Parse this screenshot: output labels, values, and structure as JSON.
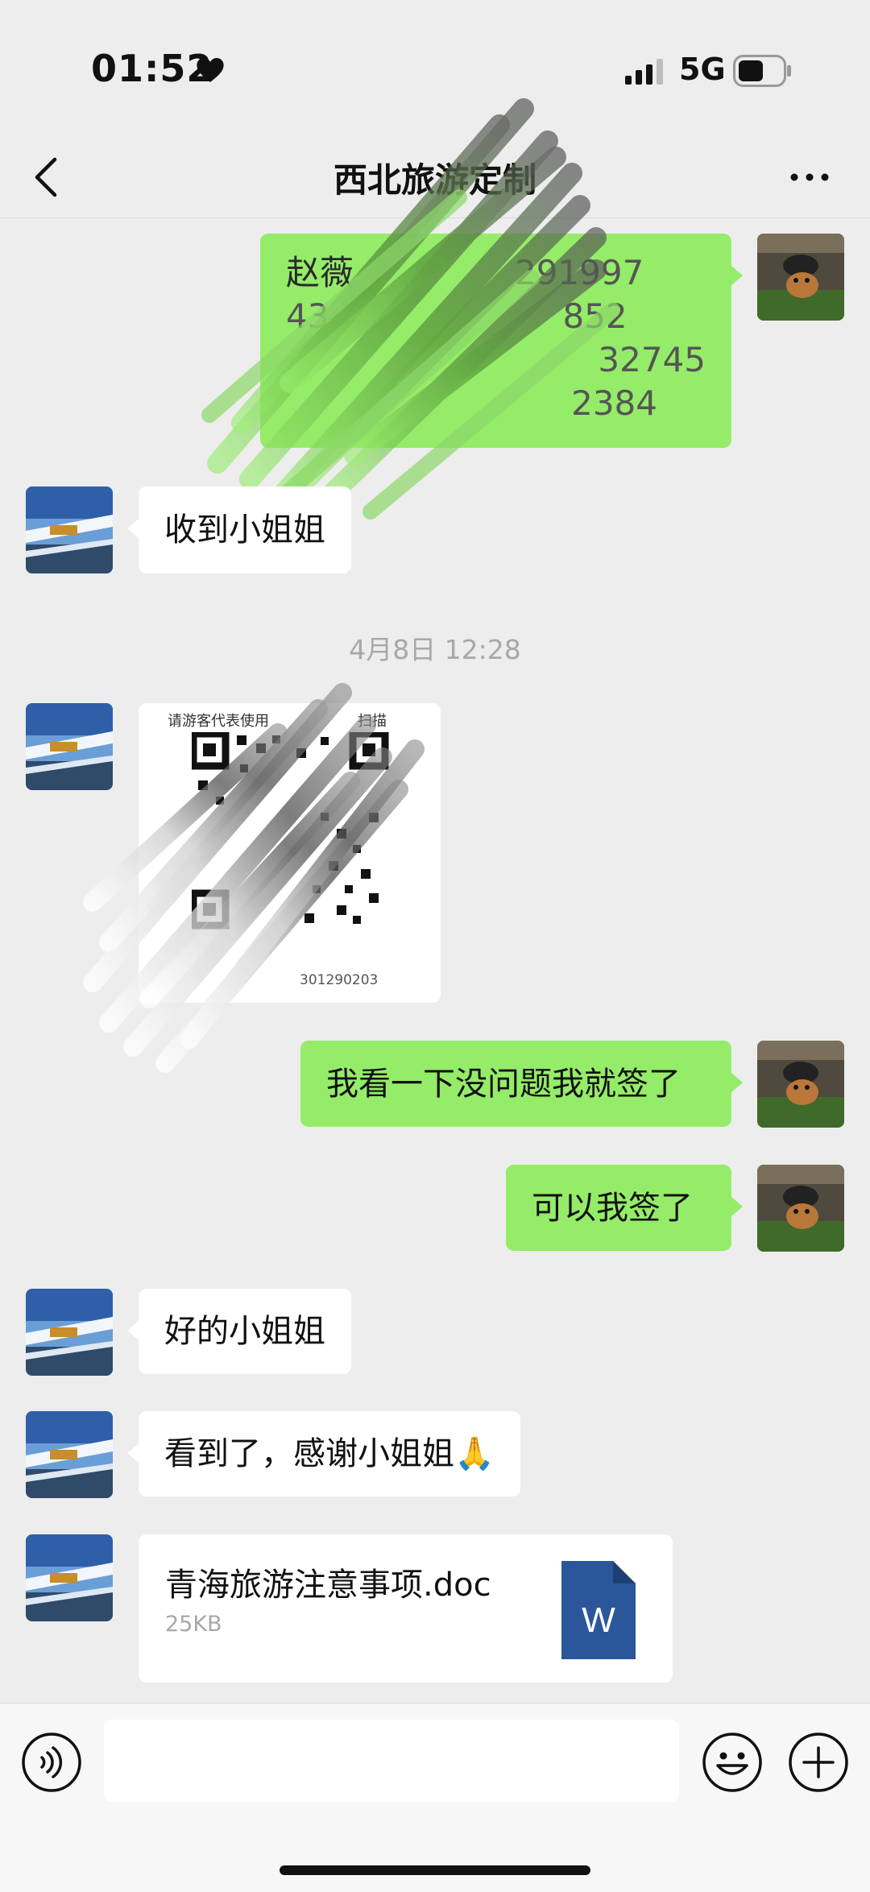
{
  "status_bar": {
    "time": "01:52",
    "network": "5G",
    "icons": [
      "heart-icon",
      "signal-icon",
      "battery-icon"
    ]
  },
  "nav": {
    "title": "西北旅游定制",
    "back_icon": "chevron-left-icon",
    "more_icon": "more-icon"
  },
  "colors": {
    "outgoing_bubble": "#95ec69",
    "incoming_bubble": "#ffffff",
    "background": "#ededed",
    "word_blue": "#2b579a"
  },
  "messages": {
    "m1": {
      "line1": "赵薇",
      "line1_tail": "291997",
      "line2a": "43",
      "line2b": "852",
      "line3": "32745",
      "line4": "2384"
    },
    "m2": "收到小姐姐",
    "timestamp": "4月8日 12:28",
    "qr": {
      "caption": "请游客代表使用",
      "caption_tail": "扫描",
      "code": "301290203"
    },
    "m4": "我看一下没问题我就签了",
    "m5": "可以我签了",
    "m6": "好的小姐姐",
    "m7": "看到了，感谢小姐姐🙏",
    "file": {
      "name": "青海旅游注意事项.doc",
      "size": "25KB",
      "icon_letter": "W"
    }
  },
  "input_bar": {
    "placeholder": "",
    "icons": [
      "voice-icon",
      "emoji-icon",
      "plus-icon"
    ]
  }
}
